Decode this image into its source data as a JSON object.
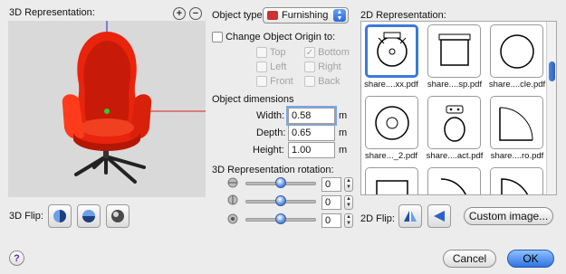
{
  "left": {
    "title": "3D Representation:",
    "zoom_in_icon": "zoom-in-icon",
    "zoom_out_icon": "zoom-out-icon",
    "flip_label": "3D Flip:"
  },
  "middle": {
    "object_type_label": "Object type:",
    "object_type_value": "Furnishing",
    "change_origin_label": "Change Object Origin to:",
    "origin": {
      "top": "Top",
      "bottom": "Bottom",
      "left": "Left",
      "right": "Right",
      "front": "Front",
      "back": "Back"
    },
    "dimensions_label": "Object dimensions",
    "width_label": "Width:",
    "width_value": "0.58",
    "depth_label": "Depth:",
    "depth_value": "0.65",
    "height_label": "Height:",
    "height_value": "1.00",
    "unit": "m",
    "rotation_label": "3D Representation rotation:",
    "rot_x": "0",
    "rot_y": "0",
    "rot_z": "0"
  },
  "right": {
    "title": "2D Representation:",
    "tiles": [
      {
        "label": "share....xx.pdf"
      },
      {
        "label": "share....sp.pdf"
      },
      {
        "label": "share....cle.pdf"
      },
      {
        "label": "share..._2.pdf"
      },
      {
        "label": "share....act.pdf"
      },
      {
        "label": "share....ro.pdf"
      }
    ],
    "flip_label": "2D Flip:",
    "custom_image": "Custom image..."
  },
  "footer": {
    "help": "?",
    "cancel": "Cancel",
    "ok": "OK"
  },
  "colors": {
    "accent": "#3b7ad8",
    "chair": "#e8240d",
    "view_bg": "#d9d9d9"
  }
}
